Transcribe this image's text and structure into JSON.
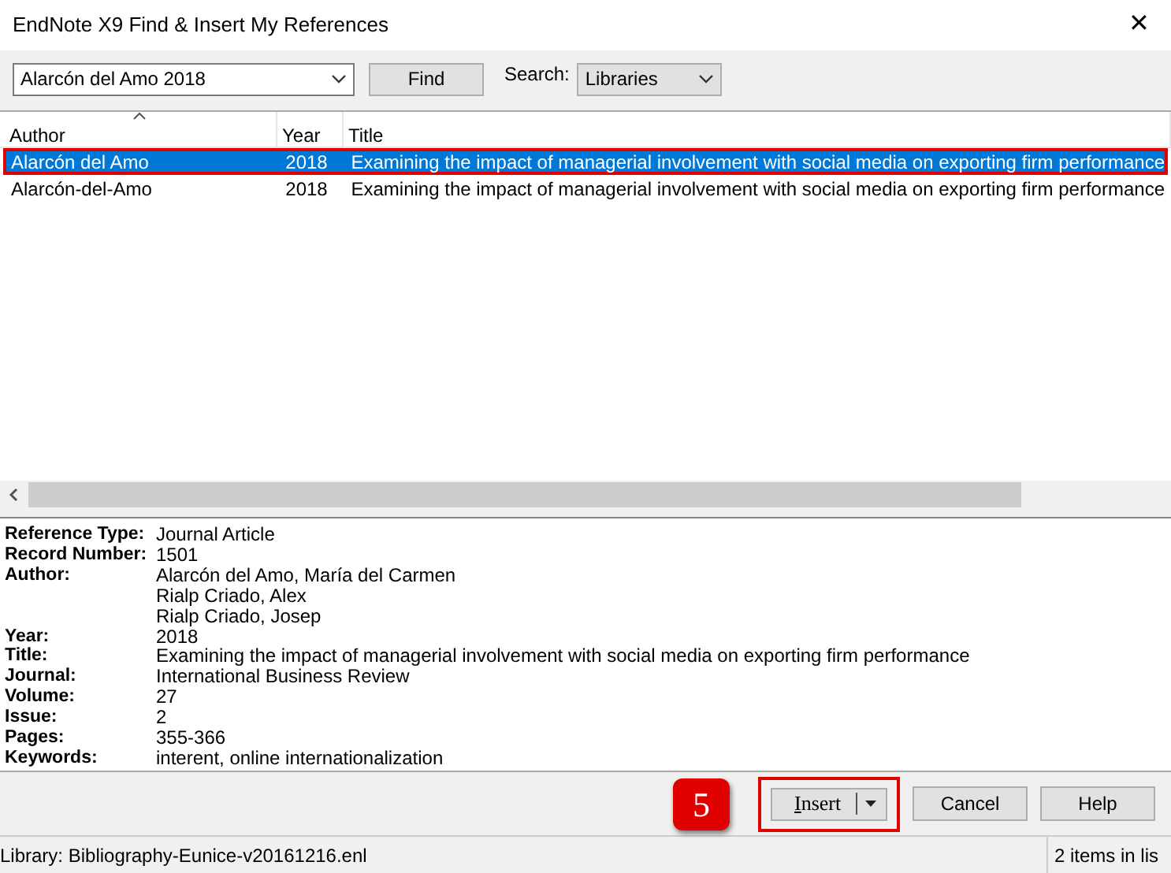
{
  "window": {
    "title": "EndNote X9 Find & Insert My References",
    "close": "✕"
  },
  "search": {
    "value": "Alarcón del Amo 2018",
    "find_button": "Find",
    "search_label": "Search:",
    "scope": "Libraries"
  },
  "table": {
    "columns": [
      {
        "label": "Author",
        "sorted": true
      },
      {
        "label": "Year",
        "sorted": false
      },
      {
        "label": "Title",
        "sorted": false
      }
    ],
    "rows": [
      {
        "author": "Alarcón del Amo",
        "year": "2018",
        "title": "Examining the impact of managerial involvement with social media on exporting firm performance",
        "selected": true,
        "highlighted": true
      },
      {
        "author": "Alarcón-del-Amo",
        "year": "2018",
        "title": "Examining the impact of managerial involvement with social media on exporting firm performance",
        "selected": false,
        "highlighted": false
      }
    ]
  },
  "details": [
    {
      "label": "Reference Type:",
      "values": [
        "Journal Article"
      ]
    },
    {
      "label": "Record Number:",
      "values": [
        "1501"
      ]
    },
    {
      "label": "Author:",
      "values": [
        "Alarcón del Amo, María del Carmen",
        "Rialp Criado, Alex",
        "Rialp Criado, Josep"
      ]
    },
    {
      "label": "Year:",
      "values": [
        "2018"
      ]
    },
    {
      "label": "Title:",
      "values": [
        "Examining the impact of managerial involvement with social media on exporting firm performance"
      ]
    },
    {
      "label": "Journal:",
      "values": [
        "International Business Review"
      ]
    },
    {
      "label": "Volume:",
      "values": [
        "27"
      ]
    },
    {
      "label": "Issue:",
      "values": [
        "2"
      ]
    },
    {
      "label": "Pages:",
      "values": [
        "355-366"
      ]
    },
    {
      "label": "Keywords:",
      "values": [
        "interent, online internationalization"
      ]
    }
  ],
  "step_badge": "5",
  "buttons": [
    {
      "label": "Insert",
      "kind": "split",
      "highlighted": true
    },
    {
      "label": "Cancel",
      "kind": "plain",
      "highlighted": false
    },
    {
      "label": "Help",
      "kind": "plain",
      "highlighted": false
    }
  ],
  "status_bar": {
    "library": "Library: Bibliography-Eunice-v20161216.enl",
    "count": "2 items in lis"
  }
}
